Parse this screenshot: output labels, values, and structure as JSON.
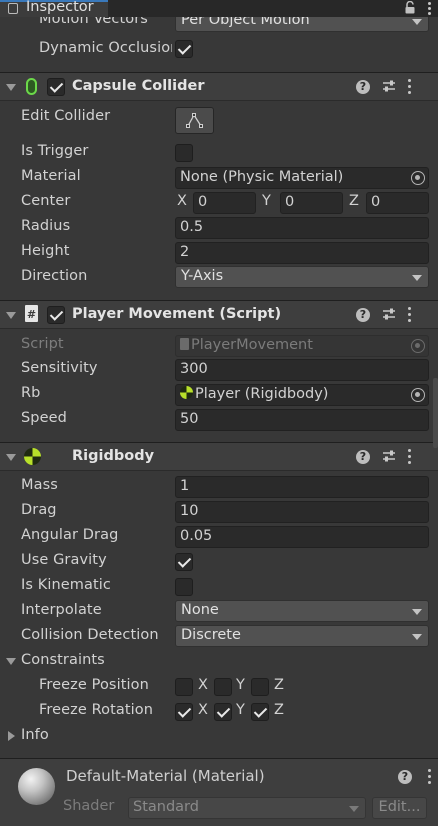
{
  "window": {
    "tab_title": "Inspector"
  },
  "top_partial": {
    "motion_vectors_label": "Motion Vectors",
    "motion_vectors_value": "Per Object Motion",
    "dynamic_occlusion_label": "Dynamic Occlusion",
    "dynamic_occlusion_checked": true
  },
  "capsule_collider": {
    "title": "Capsule Collider",
    "enabled": true,
    "edit_collider_label": "Edit Collider",
    "is_trigger_label": "Is Trigger",
    "is_trigger": false,
    "material_label": "Material",
    "material_value": "None (Physic Material)",
    "center_label": "Center",
    "center": {
      "x_label": "X",
      "x": "0",
      "y_label": "Y",
      "y": "0",
      "z_label": "Z",
      "z": "0"
    },
    "radius_label": "Radius",
    "radius_value": "0.5",
    "height_label": "Height",
    "height_value": "2",
    "direction_label": "Direction",
    "direction_value": "Y-Axis"
  },
  "player_movement": {
    "title": "Player Movement (Script)",
    "enabled": true,
    "script_label": "Script",
    "script_value": "PlayerMovement",
    "sensitivity_label": "Sensitivity",
    "sensitivity_value": "300",
    "rb_label": "Rb",
    "rb_value": "Player (Rigidbody)",
    "speed_label": "Speed",
    "speed_value": "50"
  },
  "rigidbody": {
    "title": "Rigidbody",
    "mass_label": "Mass",
    "mass_value": "1",
    "drag_label": "Drag",
    "drag_value": "10",
    "angular_drag_label": "Angular Drag",
    "angular_drag_value": "0.05",
    "use_gravity_label": "Use Gravity",
    "use_gravity": true,
    "is_kinematic_label": "Is Kinematic",
    "is_kinematic": false,
    "interpolate_label": "Interpolate",
    "interpolate_value": "None",
    "collision_detection_label": "Collision Detection",
    "collision_detection_value": "Discrete",
    "constraints_label": "Constraints",
    "freeze_position_label": "Freeze Position",
    "freeze_position": {
      "x": false,
      "y": false,
      "z": false
    },
    "freeze_rotation_label": "Freeze Rotation",
    "freeze_rotation": {
      "x": true,
      "y": true,
      "z": true
    },
    "axis_labels": {
      "x": "X",
      "y": "Y",
      "z": "Z"
    },
    "info_label": "Info"
  },
  "material": {
    "title": "Default-Material (Material)",
    "shader_label": "Shader",
    "shader_value": "Standard",
    "edit_label": "Edit..."
  },
  "colors": {
    "background": "#383838",
    "header": "#3e3e3e",
    "field": "#2a2a2a",
    "dropdown": "#515151",
    "text": "#d2d2d2",
    "capsule_icon": "#6cd94a",
    "rigidbody_icon": "#b8e02a"
  },
  "icons": {
    "lock": "lock-icon",
    "kebab": "kebab-menu-icon",
    "help": "help-icon",
    "preset": "preset-icon",
    "capsule": "capsule-collider-icon",
    "script": "script-icon",
    "rigidbody": "rigidbody-icon",
    "edit_collider": "edit-collider-icon",
    "object_picker": "object-picker-icon",
    "material_sphere": "material-sphere-icon"
  }
}
